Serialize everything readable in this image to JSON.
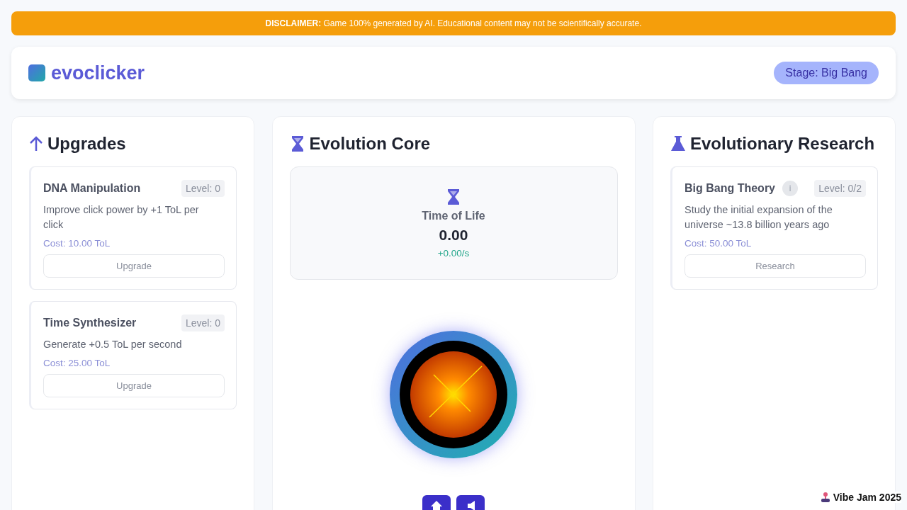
{
  "disclaimer": "**DISCLAIMER:** Game 100% generated by AI. Educational content may not be scientifically accurate.",
  "header": {
    "title": "evoclicker",
    "stage": "Stage: Big Bang"
  },
  "upgrades": {
    "title": "Upgrades",
    "items": [
      {
        "name": "DNA Manipulation",
        "level": "Level: 0",
        "description": "Improve click power by +1 ToL per click",
        "cost": "Cost: 10.00 ToL",
        "button": "Upgrade"
      },
      {
        "name": "Time Synthesizer",
        "level": "Level: 0",
        "description": "Generate +0.5 ToL per second",
        "cost": "Cost: 25.00 ToL",
        "button": "Upgrade"
      }
    ]
  },
  "core": {
    "title": "Evolution Core",
    "resource_label": "Time of Life",
    "resource_value": "0.00",
    "rate": "+0.00/s"
  },
  "research": {
    "title": "Evolutionary Research",
    "items": [
      {
        "name": "Big Bang Theory",
        "info": "i",
        "level": "Level: 0/2",
        "description": "Study the initial expansion of the universe ~13.8 billion years ago",
        "cost": "Cost: 50.00 ToL",
        "button": "Research"
      }
    ]
  },
  "badge": "Vibe Jam 2025"
}
